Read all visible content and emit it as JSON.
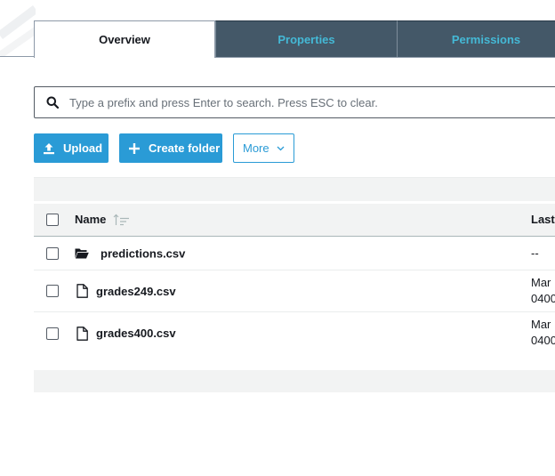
{
  "tabs": [
    {
      "label": "Overview",
      "active": true
    },
    {
      "label": "Properties",
      "active": false
    },
    {
      "label": "Permissions",
      "active": false
    }
  ],
  "search": {
    "placeholder": "Type a prefix and press Enter to search. Press ESC to clear.",
    "value": "",
    "icon": "search-icon"
  },
  "actions": {
    "upload_label": "Upload",
    "create_folder_label": "Create folder",
    "more_label": "More"
  },
  "table": {
    "columns": {
      "name": "Name",
      "last_modified": "Last"
    },
    "rows": [
      {
        "type": "folder",
        "name": "predictions.csv",
        "last_line1": "--",
        "last_line2": ""
      },
      {
        "type": "file",
        "name": "grades249.csv",
        "last_line1": "Mar",
        "last_line2": "0400"
      },
      {
        "type": "file",
        "name": "grades400.csv",
        "last_line1": "Mar",
        "last_line2": "0400"
      }
    ]
  },
  "colors": {
    "accent": "#2a9bd6",
    "tab_inactive_bg": "#445868",
    "tab_inactive_text": "#44b9d6",
    "table_header_bg": "#f2f3f3"
  }
}
